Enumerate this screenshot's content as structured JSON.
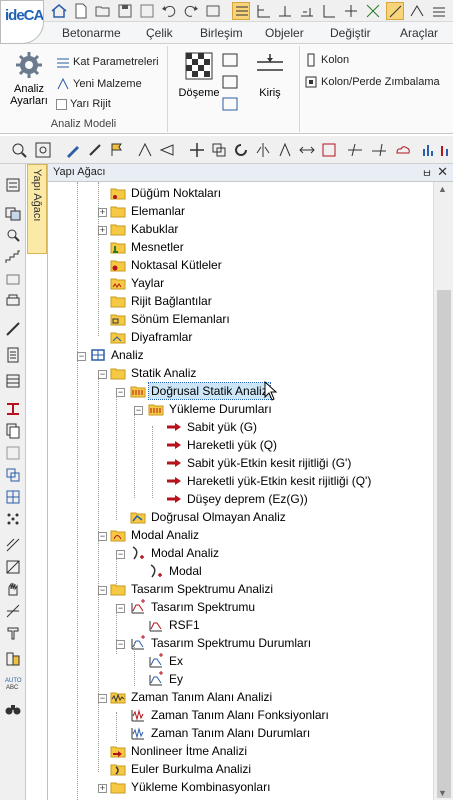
{
  "app": {
    "logo_text": "ideCAD"
  },
  "ribbon_tabs": [
    "Betonarme",
    "Çelik",
    "Birleşim",
    "Objeler",
    "Değiştir",
    "Araçlar"
  ],
  "ribbon": {
    "analiz_ayarlari_line1": "Analiz",
    "analiz_ayarlari_line2": "Ayarları",
    "kat_parametreleri": "Kat Parametreleri",
    "yeni_malzeme": "Yeni Malzeme",
    "yari_rijit": "Yarı Rijit",
    "group_label": "Analiz Modeli",
    "doseme": "Döşeme",
    "kiris": "Kiriş",
    "kolon": "Kolon",
    "kolon_perde_zimbalama": "Kolon/Perde Zımbalama"
  },
  "side_tab": "Yapı Ağacı",
  "panel": {
    "title": "Yapı Ağacı",
    "pin": "ㅂ",
    "close": "✕"
  },
  "tree": {
    "items": [
      {
        "label": "Düğüm Noktaları",
        "icon": "node-folder-icon"
      },
      {
        "label": "Elemanlar",
        "icon": "folder-icon"
      },
      {
        "label": "Kabuklar",
        "icon": "folder-icon"
      },
      {
        "label": "Mesnetler",
        "icon": "support-folder-icon"
      },
      {
        "label": "Noktasal Kütleler",
        "icon": "mass-folder-icon"
      },
      {
        "label": "Yaylar",
        "icon": "spring-folder-icon"
      },
      {
        "label": "Rijit Bağlantılar",
        "icon": "folder-icon"
      },
      {
        "label": "Sönüm Elemanları",
        "icon": "damper-folder-icon"
      },
      {
        "label": "Diyaframlar",
        "icon": "diaphragm-folder-icon"
      },
      {
        "label": "Analiz",
        "icon": "analysis-icon"
      },
      {
        "label": "Statik Analiz",
        "icon": "folder-icon"
      },
      {
        "label": "Doğrusal Statik Analiz",
        "icon": "load-folder-icon"
      },
      {
        "label": "Yükleme Durumları",
        "icon": "load-folder-icon"
      },
      {
        "label": "Sabit yük (G)",
        "icon": "arrow-icon"
      },
      {
        "label": "Hareketli yük (Q)",
        "icon": "arrow-icon"
      },
      {
        "label": "Sabit yük-Etkin kesit rijitliği (G')",
        "icon": "arrow-icon"
      },
      {
        "label": "Hareketli yük-Etkin kesit rijitliği (Q')",
        "icon": "arrow-icon"
      },
      {
        "label": "Düşey deprem (Ez(G))",
        "icon": "arrow-icon"
      },
      {
        "label": "Doğrusal Olmayan Analiz",
        "icon": "nonlinear-icon"
      },
      {
        "label": "Modal Analiz",
        "icon": "modal-folder-icon"
      },
      {
        "label": "Modal Analiz",
        "icon": "modal-icon"
      },
      {
        "label": "Modal",
        "icon": "modal-icon"
      },
      {
        "label": "Tasarım Spektrumu Analizi",
        "icon": "folder-icon"
      },
      {
        "label": "Tasarım Spektrumu",
        "icon": "spectrum-icon"
      },
      {
        "label": "RSF1",
        "icon": "spectrum-icon"
      },
      {
        "label": "Tasarım Spektrumu Durumları",
        "icon": "spectrum-icon"
      },
      {
        "label": "Ex",
        "icon": "spectrum-icon"
      },
      {
        "label": "Ey",
        "icon": "spectrum-icon"
      },
      {
        "label": "Zaman Tanım Alanı Analizi",
        "icon": "time-history-folder-icon"
      },
      {
        "label": "Zaman Tanım Alanı Fonksiyonları",
        "icon": "time-history-icon"
      },
      {
        "label": "Zaman Tanım Alanı Durumları",
        "icon": "time-history-icon"
      },
      {
        "label": "Nonlineer İtme Analizi",
        "icon": "pushover-folder-icon"
      },
      {
        "label": "Euler Burkulma Analizi",
        "icon": "buckling-folder-icon"
      },
      {
        "label": "Yükleme Kombinasyonları",
        "icon": "folder-icon"
      }
    ]
  },
  "colors": {
    "accent": "#1f62b6",
    "selection_bg": "#cde6f7",
    "folder": "#f6c945",
    "arrow": "#b5121b"
  }
}
